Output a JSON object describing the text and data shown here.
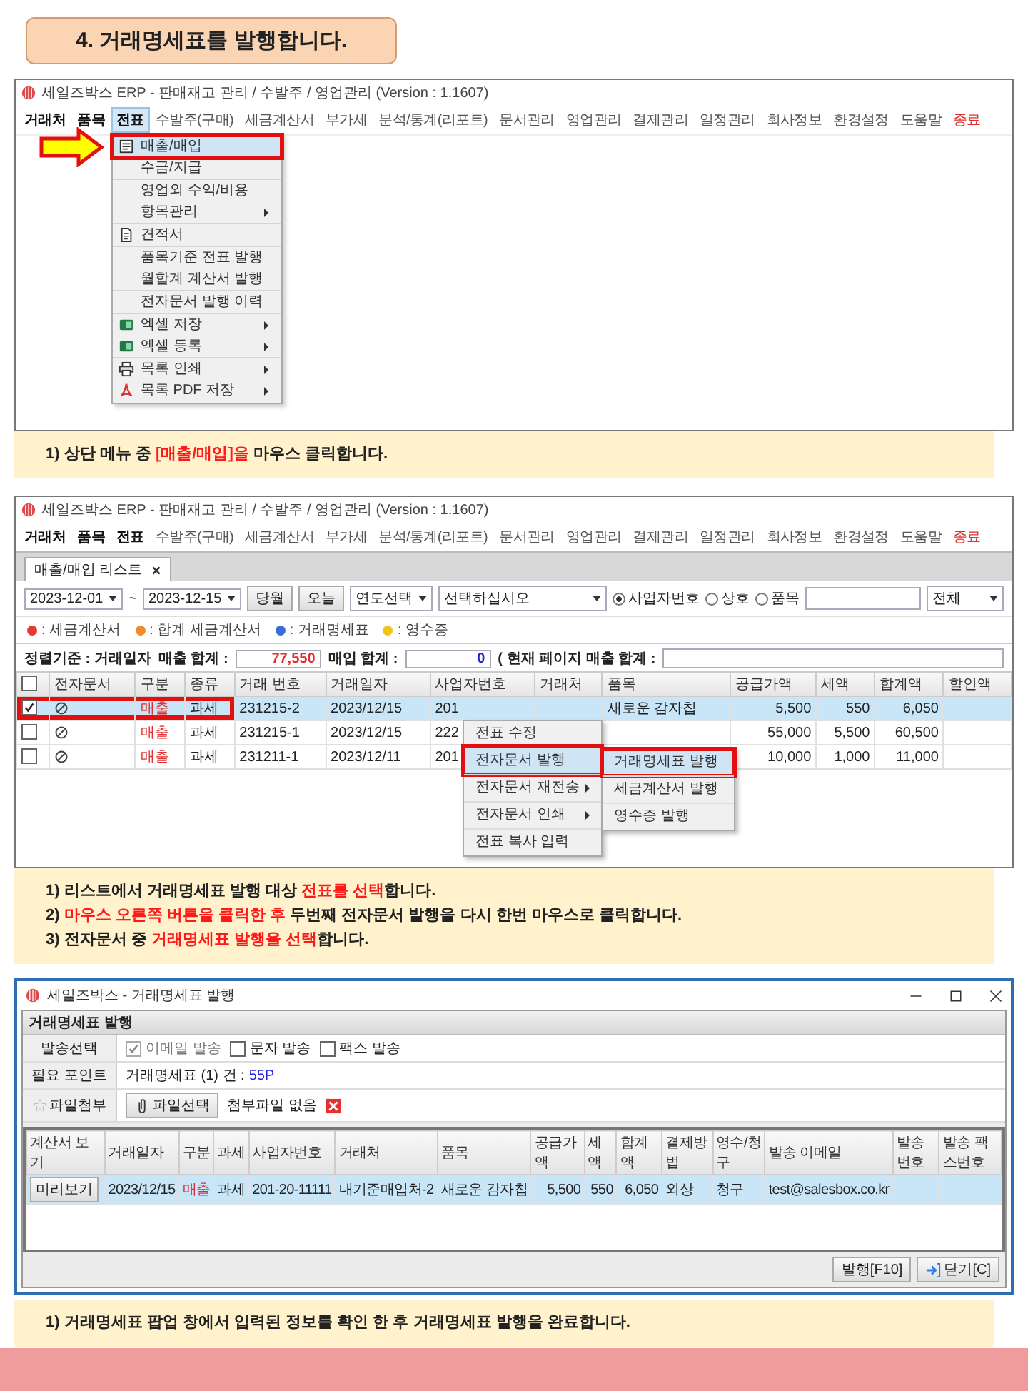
{
  "heading": {
    "text": "4. 거래명세표를 발행합니다."
  },
  "step_1": {
    "window_title": "세일즈박스 ERP - 판매재고 관리 / 수발주 / 영업관리 (Version : 1.1607)",
    "menu": [
      {
        "label": "거래처",
        "kind": "normal",
        "emphasis": true,
        "selected": false
      },
      {
        "label": "품목",
        "kind": "normal",
        "emphasis": true,
        "selected": false
      },
      {
        "label": "전표",
        "kind": "normal",
        "emphasis": true,
        "selected": true
      },
      {
        "label": "수발주(구매)",
        "kind": "normal",
        "emphasis": false,
        "selected": false
      },
      {
        "label": "세금계산서",
        "kind": "normal",
        "emphasis": false,
        "selected": false
      },
      {
        "label": "부가세",
        "kind": "normal",
        "emphasis": false,
        "selected": false
      },
      {
        "label": "분석/통계(리포트)",
        "kind": "normal",
        "emphasis": false,
        "selected": false
      },
      {
        "label": "문서관리",
        "kind": "normal",
        "emphasis": false,
        "selected": false
      },
      {
        "label": "영업관리",
        "kind": "normal",
        "emphasis": false,
        "selected": false
      },
      {
        "label": "결제관리",
        "kind": "normal",
        "emphasis": false,
        "selected": false
      },
      {
        "label": "일정관리",
        "kind": "normal",
        "emphasis": false,
        "selected": false
      },
      {
        "label": "회사정보",
        "kind": "normal",
        "emphasis": false,
        "selected": false
      },
      {
        "label": "환경설정",
        "kind": "normal",
        "emphasis": false,
        "selected": false
      },
      {
        "label": "도움말",
        "kind": "normal",
        "emphasis": false,
        "selected": false
      },
      {
        "label": "종료",
        "kind": "exit",
        "emphasis": false,
        "selected": false
      }
    ],
    "dropdown": {
      "groups": [
        {
          "items": [
            {
              "label": "매출/매입",
              "kind": "form",
              "has_submenu": false,
              "selected": true,
              "annotated": true
            },
            {
              "label": "수금/지급",
              "kind": "text",
              "has_submenu": false,
              "selected": false,
              "annotated": false
            }
          ]
        },
        {
          "items": [
            {
              "label": "영업외 수익/비용",
              "kind": "text",
              "has_submenu": false,
              "selected": false,
              "annotated": false
            },
            {
              "label": "항목관리",
              "kind": "text",
              "has_submenu": true,
              "selected": false,
              "annotated": false
            }
          ]
        },
        {
          "items": [
            {
              "label": "견적서",
              "kind": "document",
              "has_submenu": false,
              "selected": false,
              "annotated": false
            }
          ]
        },
        {
          "items": [
            {
              "label": "품목기준 전표 발행",
              "kind": "text",
              "has_submenu": false,
              "selected": false,
              "annotated": false
            },
            {
              "label": "월합계 계산서 발행",
              "kind": "text",
              "has_submenu": false,
              "selected": false,
              "annotated": false
            }
          ]
        },
        {
          "items": [
            {
              "label": "전자문서 발행 이력",
              "kind": "text",
              "has_submenu": false,
              "selected": false,
              "annotated": false
            }
          ]
        },
        {
          "items": [
            {
              "label": "엑셀 저장",
              "kind": "spreadsheet",
              "has_submenu": true,
              "selected": false,
              "annotated": false
            },
            {
              "label": "엑셀 등록",
              "kind": "spreadsheet",
              "has_submenu": true,
              "selected": false,
              "annotated": false
            }
          ]
        },
        {
          "items": [
            {
              "label": "목록 인쇄",
              "kind": "printer",
              "has_submenu": true,
              "selected": false,
              "annotated": false
            },
            {
              "label": "목록 PDF 저장",
              "kind": "pdf",
              "has_submenu": true,
              "selected": false,
              "annotated": false
            }
          ]
        }
      ]
    },
    "caption": [
      [
        {
          "text": "1) 상단 메뉴 중 ",
          "highlight": false
        },
        {
          "text": "[매출/매입]을",
          "highlight": true
        },
        {
          "text": " 마우스 클릭합니다.",
          "highlight": false
        }
      ]
    ]
  },
  "step_2": {
    "window_title": "세일즈박스 ERP - 판매재고 관리 / 수발주 / 영업관리 (Version : 1.1607)",
    "menu": [
      {
        "label": "거래처",
        "kind": "normal",
        "emphasis": true,
        "selected": false
      },
      {
        "label": "품목",
        "kind": "normal",
        "emphasis": true,
        "selected": false
      },
      {
        "label": "전표",
        "kind": "normal",
        "emphasis": true,
        "selected": false
      },
      {
        "label": "수발주(구매)",
        "kind": "normal",
        "emphasis": false,
        "selected": false
      },
      {
        "label": "세금계산서",
        "kind": "normal",
        "emphasis": false,
        "selected": false
      },
      {
        "label": "부가세",
        "kind": "normal",
        "emphasis": false,
        "selected": false
      },
      {
        "label": "분석/통계(리포트)",
        "kind": "normal",
        "emphasis": false,
        "selected": false
      },
      {
        "label": "문서관리",
        "kind": "normal",
        "emphasis": false,
        "selected": false
      },
      {
        "label": "영업관리",
        "kind": "normal",
        "emphasis": false,
        "selected": false
      },
      {
        "label": "결제관리",
        "kind": "normal",
        "emphasis": false,
        "selected": false
      },
      {
        "label": "일정관리",
        "kind": "normal",
        "emphasis": false,
        "selected": false
      },
      {
        "label": "회사정보",
        "kind": "normal",
        "emphasis": false,
        "selected": false
      },
      {
        "label": "환경설정",
        "kind": "normal",
        "emphasis": false,
        "selected": false
      },
      {
        "label": "도움말",
        "kind": "normal",
        "emphasis": false,
        "selected": false
      },
      {
        "label": "종료",
        "kind": "exit",
        "emphasis": false,
        "selected": false
      }
    ],
    "tab": {
      "label": "매출/매입 리스트"
    },
    "filters": {
      "start_date": "2023-12-01",
      "date_separator": "~",
      "end_date": "2023-12-15",
      "buttons": [
        "당월",
        "오늘"
      ],
      "year_select": "연도선택",
      "option_select": "선택하십시오",
      "radios": [
        {
          "label": "사업자번호",
          "selected": true
        },
        {
          "label": "상호",
          "selected": false
        },
        {
          "label": "품목",
          "selected": false
        }
      ],
      "scope_select": "전체"
    },
    "legend": [
      {
        "label": ": 세금계산서",
        "color": "#e53935"
      },
      {
        "label": ": 합계 세금계산서",
        "color": "#f08a30"
      },
      {
        "label": ": 거래명세표",
        "color": "#3b6fd8"
      },
      {
        "label": ": 영수증",
        "color": "#f0c419"
      }
    ],
    "summary": {
      "sort_label": "정렬기준 : 거래일자",
      "sales_total_label": "매출 합계 :",
      "sales_total": "77,550",
      "purchase_total_label": "매입 합계 :",
      "purchase_total": "0",
      "page_total_label": "( 현재 페이지 매출 합계 :"
    },
    "table": {
      "header_checked": false,
      "columns": [
        {
          "label": "전자문서",
          "kind": "icon"
        },
        {
          "label": "구분",
          "kind": "category"
        },
        {
          "label": "종류",
          "kind": "text"
        },
        {
          "label": "거래 번호",
          "kind": "text"
        },
        {
          "label": "거래일자",
          "kind": "text"
        },
        {
          "label": "사업자번호",
          "kind": "anchor"
        },
        {
          "label": "거래처",
          "kind": "text"
        },
        {
          "label": "품목",
          "kind": "text"
        },
        {
          "label": "공급가액",
          "kind": "number"
        },
        {
          "label": "세액",
          "kind": "number"
        },
        {
          "label": "합계액",
          "kind": "number"
        },
        {
          "label": "할인액",
          "kind": "number"
        }
      ],
      "rows": [
        {
          "checked": true,
          "selected": true,
          "annotated": true,
          "cells": [
            null,
            "매출",
            "과세",
            "231215-2",
            "2023/12/15",
            "201",
            null,
            "새로운 감자칩",
            "5,500",
            "550",
            "6,050",
            null
          ]
        },
        {
          "checked": false,
          "selected": false,
          "annotated": false,
          "cells": [
            null,
            "매출",
            "과세",
            "231215-1",
            "2023/12/15",
            "222",
            null,
            null,
            "55,000",
            "5,500",
            "60,500",
            null
          ]
        },
        {
          "checked": false,
          "selected": false,
          "annotated": false,
          "cells": [
            null,
            "매출",
            "과세",
            "231211-1",
            "2023/12/11",
            "201",
            null,
            null,
            "10,000",
            "1,000",
            "11,000",
            null
          ]
        }
      ]
    },
    "context_menu": {
      "items": [
        {
          "label": "전표 수정",
          "has_submenu": false,
          "selected": false,
          "annotated": false
        },
        {
          "label": "전자문서 발행",
          "has_submenu": false,
          "selected": true,
          "annotated": true
        },
        {
          "label": "전자문서 재전송",
          "has_submenu": true,
          "selected": false,
          "annotated": false
        },
        {
          "label": "전자문서 인쇄",
          "has_submenu": true,
          "selected": false,
          "annotated": false
        },
        {
          "label": "전표 복사 입력",
          "has_submenu": false,
          "selected": false,
          "annotated": false
        }
      ],
      "submenu": [
        {
          "label": "거래명세표 발행",
          "selected": true,
          "annotated": true
        },
        {
          "label": "세금계산서 발행",
          "selected": false,
          "annotated": false
        },
        {
          "label": "영수증 발행",
          "selected": false,
          "annotated": false
        }
      ]
    },
    "caption": [
      [
        {
          "text": "1) 리스트에서 거래명세표 발행 대상 ",
          "highlight": false
        },
        {
          "text": "전표를 선택",
          "highlight": true
        },
        {
          "text": "합니다.",
          "highlight": false
        }
      ],
      [
        {
          "text": "2) ",
          "highlight": false
        },
        {
          "text": "마우스 오른쪽 버튼을 클릭한 후",
          "highlight": true
        },
        {
          "text": " 두번째 전자문서 발행을 다시 한번 마우스로 클릭합니다.",
          "highlight": false
        }
      ],
      [
        {
          "text": "3) 전자문서 중 ",
          "highlight": false
        },
        {
          "text": "거래명세표 발행을 선택",
          "highlight": true
        },
        {
          "text": "합니다.",
          "highlight": false
        }
      ]
    ]
  },
  "step_3": {
    "window_title": "세일즈박스 - 거래명세표 발행",
    "section_title": "거래명세표 발행",
    "send_label": "발송선택",
    "send_options": [
      {
        "label": "이메일 발송",
        "checked": true,
        "disabled": true
      },
      {
        "label": "문자 발송",
        "checked": false,
        "disabled": false
      },
      {
        "label": "팩스 발송",
        "checked": false,
        "disabled": false
      }
    ],
    "points_label": "필요 포인트",
    "points_text": "거래명세표 (1) 건 :",
    "points_value": "55P",
    "attach_label": "파일첨부",
    "file_button": "파일선택",
    "attach_status": "첨부파일 없음",
    "table": {
      "columns": [
        {
          "label": "계산서 보기",
          "kind": "button"
        },
        {
          "label": "거래일자",
          "kind": "text"
        },
        {
          "label": "구분",
          "kind": "category"
        },
        {
          "label": "과세",
          "kind": "text"
        },
        {
          "label": "사업자번호",
          "kind": "text"
        },
        {
          "label": "거래처",
          "kind": "text"
        },
        {
          "label": "품목",
          "kind": "text"
        },
        {
          "label": "공급가액",
          "kind": "number"
        },
        {
          "label": "세액",
          "kind": "number"
        },
        {
          "label": "합계액",
          "kind": "number"
        },
        {
          "label": "결제방법",
          "kind": "text"
        },
        {
          "label": "영수/청구",
          "kind": "text"
        },
        {
          "label": "발송 이메일",
          "kind": "text"
        },
        {
          "label": "발송 번호",
          "kind": "text"
        },
        {
          "label": "발송 팩스번호",
          "kind": "text"
        }
      ],
      "rows": [
        {
          "selected": true,
          "cells": [
            "미리보기",
            "2023/12/15",
            "매출",
            "과세",
            "201-20-11111",
            "내기준매입처-2",
            "새로운 감자칩",
            "5,500",
            "550",
            "6,050",
            "외상",
            "청구",
            "test@salesbox.co.kr",
            null,
            null
          ]
        }
      ]
    },
    "footer_buttons": [
      {
        "label": "발행[F10]",
        "kind": "plain"
      },
      {
        "label": "닫기[C]",
        "kind": "exit"
      }
    ],
    "caption": [
      [
        {
          "text": "1) 거래명세표 팝업 창에서 입력된 정보를 확인 한 후 거래명세표 발행을 완료합니다.",
          "highlight": false
        }
      ]
    ]
  }
}
